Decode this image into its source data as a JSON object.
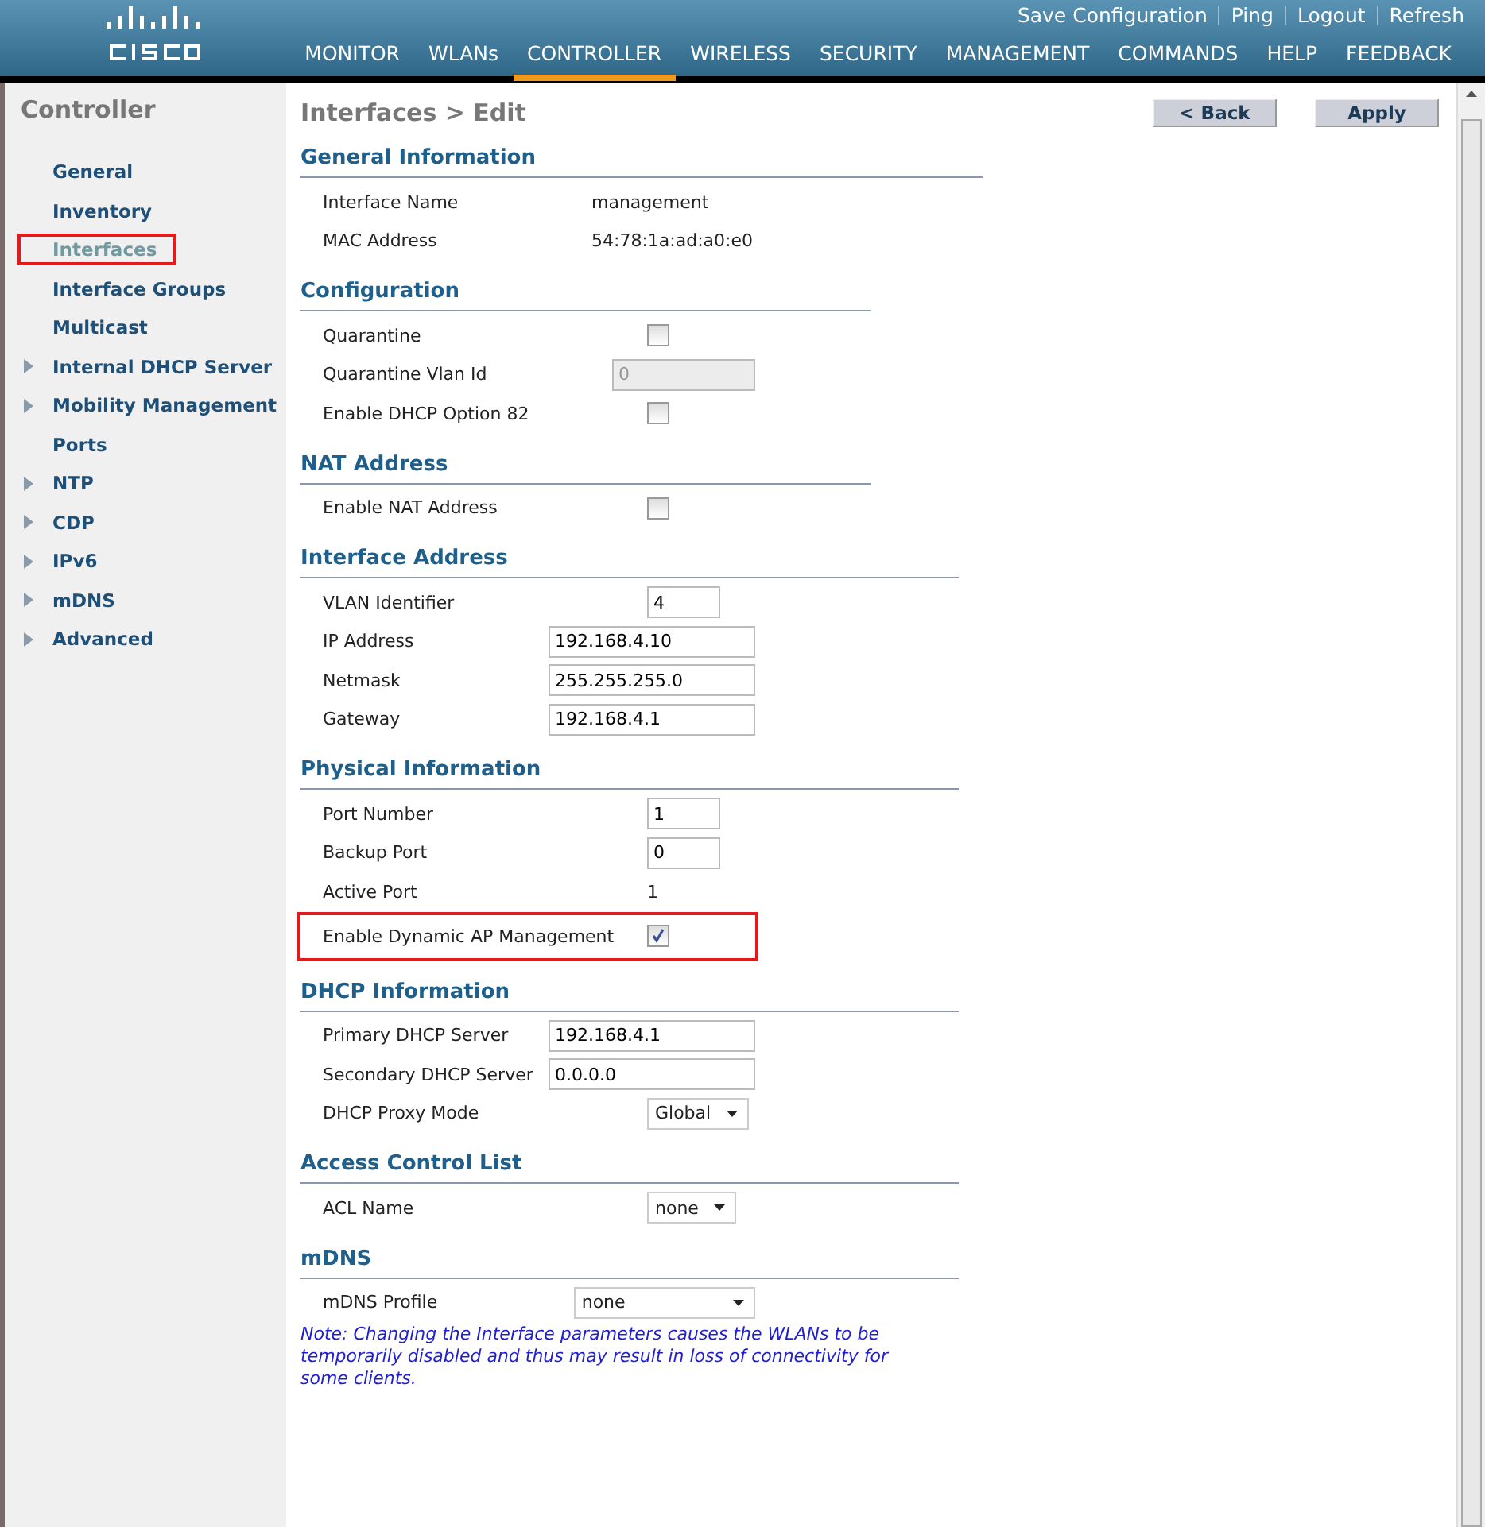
{
  "header": {
    "links": [
      "Save Configuration",
      "Ping",
      "Logout",
      "Refresh"
    ],
    "nav": [
      {
        "label": "MONITOR",
        "selected": false
      },
      {
        "label": "WLANs",
        "selected": false
      },
      {
        "label": "CONTROLLER",
        "selected": true
      },
      {
        "label": "WIRELESS",
        "selected": false
      },
      {
        "label": "SECURITY",
        "selected": false
      },
      {
        "label": "MANAGEMENT",
        "selected": false
      },
      {
        "label": "COMMANDS",
        "selected": false
      },
      {
        "label": "HELP",
        "selected": false
      },
      {
        "label": "FEEDBACK",
        "selected": false
      }
    ]
  },
  "sidebar": {
    "title": "Controller",
    "items": [
      {
        "label": "General",
        "selected": false,
        "expandable": false,
        "highlighted": false
      },
      {
        "label": "Inventory",
        "selected": false,
        "expandable": false,
        "highlighted": false
      },
      {
        "label": "Interfaces",
        "selected": true,
        "expandable": false,
        "highlighted": true
      },
      {
        "label": "Interface Groups",
        "selected": false,
        "expandable": false,
        "highlighted": false
      },
      {
        "label": "Multicast",
        "selected": false,
        "expandable": false,
        "highlighted": false
      },
      {
        "label": "Internal DHCP Server",
        "selected": false,
        "expandable": true,
        "highlighted": false
      },
      {
        "label": "Mobility Management",
        "selected": false,
        "expandable": true,
        "highlighted": false
      },
      {
        "label": "Ports",
        "selected": false,
        "expandable": false,
        "highlighted": false
      },
      {
        "label": "NTP",
        "selected": false,
        "expandable": true,
        "highlighted": false
      },
      {
        "label": "CDP",
        "selected": false,
        "expandable": true,
        "highlighted": false
      },
      {
        "label": "IPv6",
        "selected": false,
        "expandable": true,
        "highlighted": false
      },
      {
        "label": "mDNS",
        "selected": false,
        "expandable": true,
        "highlighted": false
      },
      {
        "label": "Advanced",
        "selected": false,
        "expandable": true,
        "highlighted": false
      }
    ]
  },
  "page": {
    "title": "Interfaces > Edit",
    "buttons": [
      "< Back",
      "Apply"
    ]
  },
  "sections": [
    {
      "title": "General Information",
      "rows": [
        {
          "kind": "text",
          "label": "Interface Name",
          "value": "management"
        },
        {
          "kind": "text",
          "label": "MAC Address",
          "value": "54:78:1a:ad:a0:e0"
        }
      ]
    },
    {
      "title": "Configuration",
      "rows": [
        {
          "kind": "checkbox",
          "label": "Quarantine",
          "checked": false
        },
        {
          "kind": "input-short",
          "label": "Quarantine Vlan Id",
          "value": "0",
          "disabled": true
        },
        {
          "kind": "checkbox",
          "label": "Enable DHCP Option 82",
          "checked": false
        }
      ]
    },
    {
      "title": "NAT Address",
      "rows": [
        {
          "kind": "checkbox",
          "label": "Enable NAT Address",
          "checked": false
        }
      ]
    },
    {
      "title": "Interface Address",
      "rows": [
        {
          "kind": "input-short",
          "label": "VLAN Identifier",
          "value": "4",
          "disabled": false
        },
        {
          "kind": "input",
          "label": "IP Address",
          "value": "192.168.4.10",
          "disabled": false
        },
        {
          "kind": "input",
          "label": "Netmask",
          "value": "255.255.255.0",
          "disabled": false
        },
        {
          "kind": "input",
          "label": "Gateway",
          "value": "192.168.4.1",
          "disabled": false
        }
      ]
    },
    {
      "title": "Physical Information",
      "rows": [
        {
          "kind": "input-short",
          "label": "Port Number",
          "value": "1",
          "disabled": false
        },
        {
          "kind": "input-short",
          "label": "Backup Port",
          "value": "0",
          "disabled": false
        },
        {
          "kind": "text",
          "label": "Active Port",
          "value": "1"
        },
        {
          "kind": "checkbox",
          "label": "Enable Dynamic AP Management",
          "checked": true,
          "highlighted": true
        }
      ]
    },
    {
      "title": "DHCP Information",
      "rows": [
        {
          "kind": "input",
          "label": "Primary DHCP Server",
          "value": "192.168.4.1",
          "disabled": false
        },
        {
          "kind": "input",
          "label": "Secondary DHCP Server",
          "value": "0.0.0.0",
          "disabled": false
        },
        {
          "kind": "select",
          "label": "DHCP Proxy Mode",
          "value": "Global"
        }
      ]
    },
    {
      "title": "Access Control List",
      "rows": [
        {
          "kind": "select",
          "label": "ACL Name",
          "value": "none"
        }
      ]
    },
    {
      "title": "mDNS",
      "rows": [
        {
          "kind": "select-wide",
          "label": "mDNS Profile",
          "value": "none"
        }
      ]
    }
  ],
  "note": "Note: Changing the Interface parameters causes the WLANs to be temporarily disabled and thus may result in loss of connectivity for some clients."
}
